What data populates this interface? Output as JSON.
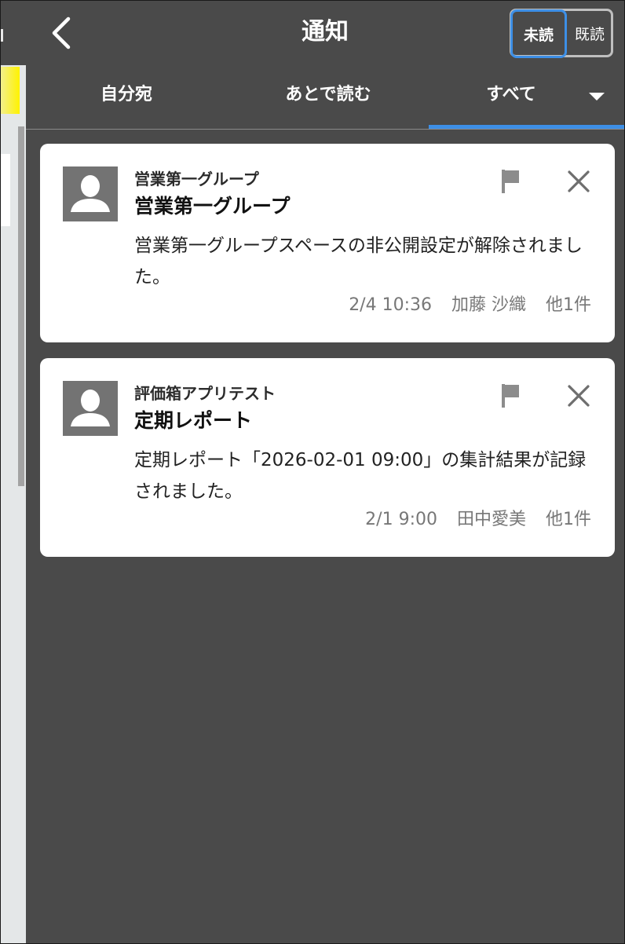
{
  "header": {
    "title": "通知",
    "unread_label": "未読",
    "read_label": "既読"
  },
  "tabs": [
    {
      "label": "自分宛"
    },
    {
      "label": "あとで読む"
    },
    {
      "label": "すべて"
    }
  ],
  "notifications": [
    {
      "space": "営業第一グループ",
      "title": "営業第一グループ",
      "message": "営業第一グループスペースの非公開設定が解除されました。",
      "datetime": "2/4 10:36",
      "user": "加藤 沙織",
      "others": "他1件"
    },
    {
      "space": "評価箱アプリテスト",
      "title": "定期レポート",
      "message": "定期レポート「2026-02-01 09:00」の集計結果が記録されました。",
      "datetime": "2/1 9:00",
      "user": "田中愛美",
      "others": "他1件"
    }
  ],
  "colors": {
    "background": "#4a4a4a",
    "accent": "#3d8fe6",
    "card": "#ffffff",
    "avatar": "#737373"
  },
  "icons": {
    "back": "chevron-left-icon",
    "dropdown": "caret-down-icon",
    "flag": "flag-icon",
    "close": "close-icon",
    "avatar": "user-silhouette-icon"
  }
}
